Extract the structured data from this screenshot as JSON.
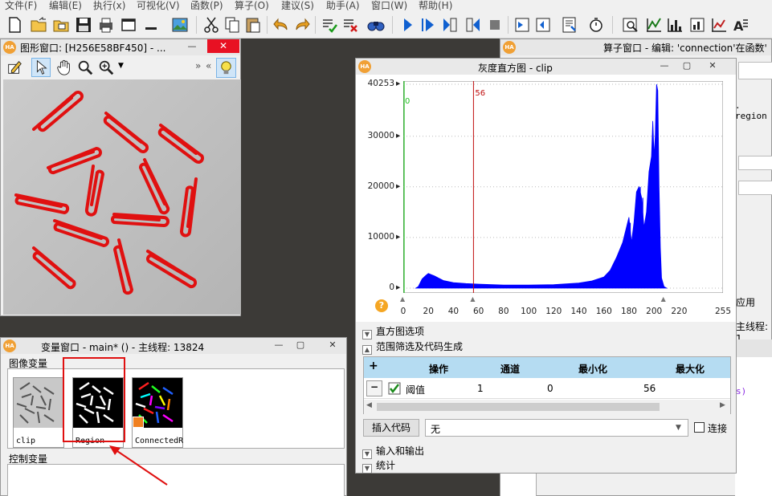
{
  "menu": [
    "文件(F)",
    "编辑(E)",
    "执行(x)",
    "可视化(V)",
    "函数(P)",
    "算子(O)",
    "建议(S)",
    "助手(A)",
    "窗口(W)",
    "帮助(H)"
  ],
  "graphics_window": {
    "title": "图形窗口: [H256E58BF450] - ...",
    "min": "—",
    "close": "✕"
  },
  "operator_window": {
    "title": "算子窗口 - 编辑:  'connection'在函数'",
    "partial_text": ". region",
    "apply": "应用",
    "thread_fragment": "主线程: 1",
    "code_fragment": "s)"
  },
  "histogram_window": {
    "title": "灰度直方图 - clip",
    "markers": {
      "green": "0",
      "red": "56"
    },
    "sections": {
      "options": "直方图选项",
      "range": "范围筛选及代码生成",
      "io": "输入和输出",
      "stats": "统计"
    },
    "table": {
      "headers": [
        "操作",
        "通道",
        "最小化",
        "最大化"
      ],
      "row": [
        "阈值",
        "1",
        "0",
        "56"
      ],
      "add": "+",
      "remove": "−"
    },
    "insert_code": "插入代码",
    "dropdown_value": "无",
    "connect_label": "连接"
  },
  "variable_window": {
    "title": "变量窗口 - main* () - 主线程: 13824",
    "image_vars_label": "图像变量",
    "control_vars_label": "控制变量",
    "thumbnails": [
      {
        "label": "clip"
      },
      {
        "label": "Region"
      },
      {
        "label": "ConnectedR"
      }
    ]
  },
  "chart_data": {
    "type": "bar",
    "title": "灰度直方图 - clip",
    "xlim": [
      0,
      255
    ],
    "ylim": [
      0,
      40253
    ],
    "x_ticks": [
      0,
      20,
      40,
      60,
      80,
      100,
      120,
      140,
      160,
      180,
      200,
      220,
      255
    ],
    "y_ticks": [
      0,
      10000,
      20000,
      30000,
      40253
    ],
    "y_tick_labels": [
      "0",
      "10000",
      "30000",
      "20000",
      "40253"
    ],
    "thresholds": {
      "min": 0,
      "max": 56
    },
    "series": [
      {
        "color": "#0000ff",
        "points": [
          [
            10,
            0
          ],
          [
            12,
            300
          ],
          [
            15,
            1800
          ],
          [
            18,
            2500
          ],
          [
            20,
            2900
          ],
          [
            22,
            2700
          ],
          [
            25,
            2400
          ],
          [
            28,
            2000
          ],
          [
            32,
            1500
          ],
          [
            40,
            1100
          ],
          [
            50,
            900
          ],
          [
            60,
            800
          ],
          [
            80,
            600
          ],
          [
            100,
            600
          ],
          [
            120,
            700
          ],
          [
            140,
            1000
          ],
          [
            150,
            1400
          ],
          [
            160,
            2200
          ],
          [
            165,
            3500
          ],
          [
            170,
            6000
          ],
          [
            175,
            9000
          ],
          [
            178,
            12000
          ],
          [
            180,
            14000
          ],
          [
            182,
            9000
          ],
          [
            184,
            13000
          ],
          [
            186,
            19000
          ],
          [
            188,
            20000
          ],
          [
            190,
            18000
          ],
          [
            192,
            12000
          ],
          [
            194,
            15000
          ],
          [
            196,
            23000
          ],
          [
            198,
            26000
          ],
          [
            199,
            33000
          ],
          [
            200,
            26000
          ],
          [
            201,
            30000
          ],
          [
            202,
            40253
          ],
          [
            203,
            39000
          ],
          [
            204,
            20000
          ],
          [
            205,
            8000
          ],
          [
            206,
            2000
          ],
          [
            208,
            300
          ],
          [
            210,
            0
          ]
        ]
      }
    ]
  }
}
